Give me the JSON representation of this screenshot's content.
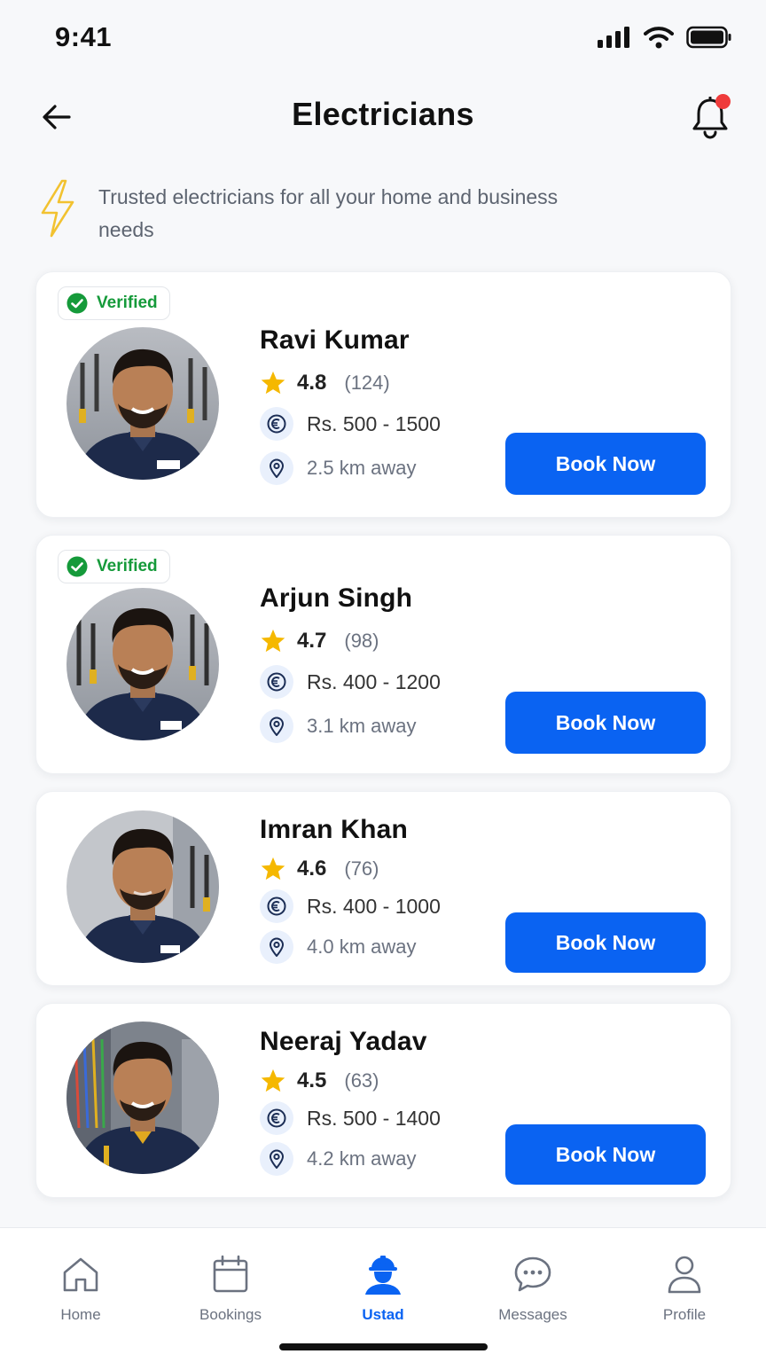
{
  "status_bar": {
    "time": "9:41"
  },
  "header": {
    "title": "Electricians"
  },
  "tagline": "Trusted electricians for all your home and business needs",
  "electricians": [
    {
      "name": "Ravi Kumar",
      "verified": true,
      "verified_label": "Verified",
      "rating": "4.8",
      "reviews": "(124)",
      "price": "Rs. 500 - 1500",
      "distance": "2.5 km away",
      "book_label": "Book Now"
    },
    {
      "name": "Arjun Singh",
      "verified": true,
      "verified_label": "Verified",
      "rating": "4.7",
      "reviews": "(98)",
      "price": "Rs. 400 - 1200",
      "distance": "3.1 km away",
      "book_label": "Book Now"
    },
    {
      "name": "Imran Khan",
      "verified": false,
      "rating": "4.6",
      "reviews": "(76)",
      "price": "Rs. 400 - 1000",
      "distance": "4.0 km away",
      "book_label": "Book Now"
    },
    {
      "name": "Neeraj Yadav",
      "verified": false,
      "rating": "4.5",
      "reviews": "(63)",
      "price": "Rs. 500 - 1400",
      "distance": "4.2 km away",
      "book_label": "Book Now"
    }
  ],
  "bottom_nav": [
    {
      "label": "Home",
      "icon": "home-icon",
      "active": false
    },
    {
      "label": "Bookings",
      "icon": "calendar-icon",
      "active": false
    },
    {
      "label": "Ustad",
      "icon": "worker-helmet-icon",
      "active": true
    },
    {
      "label": "Messages",
      "icon": "chat-bubble-icon",
      "active": false
    },
    {
      "label": "Profile",
      "icon": "user-icon",
      "active": false
    }
  ],
  "colors": {
    "accent": "#0a63f2",
    "verified_green": "#159a3a",
    "star": "#f5b800",
    "notification_dot": "#ef3b3b"
  }
}
